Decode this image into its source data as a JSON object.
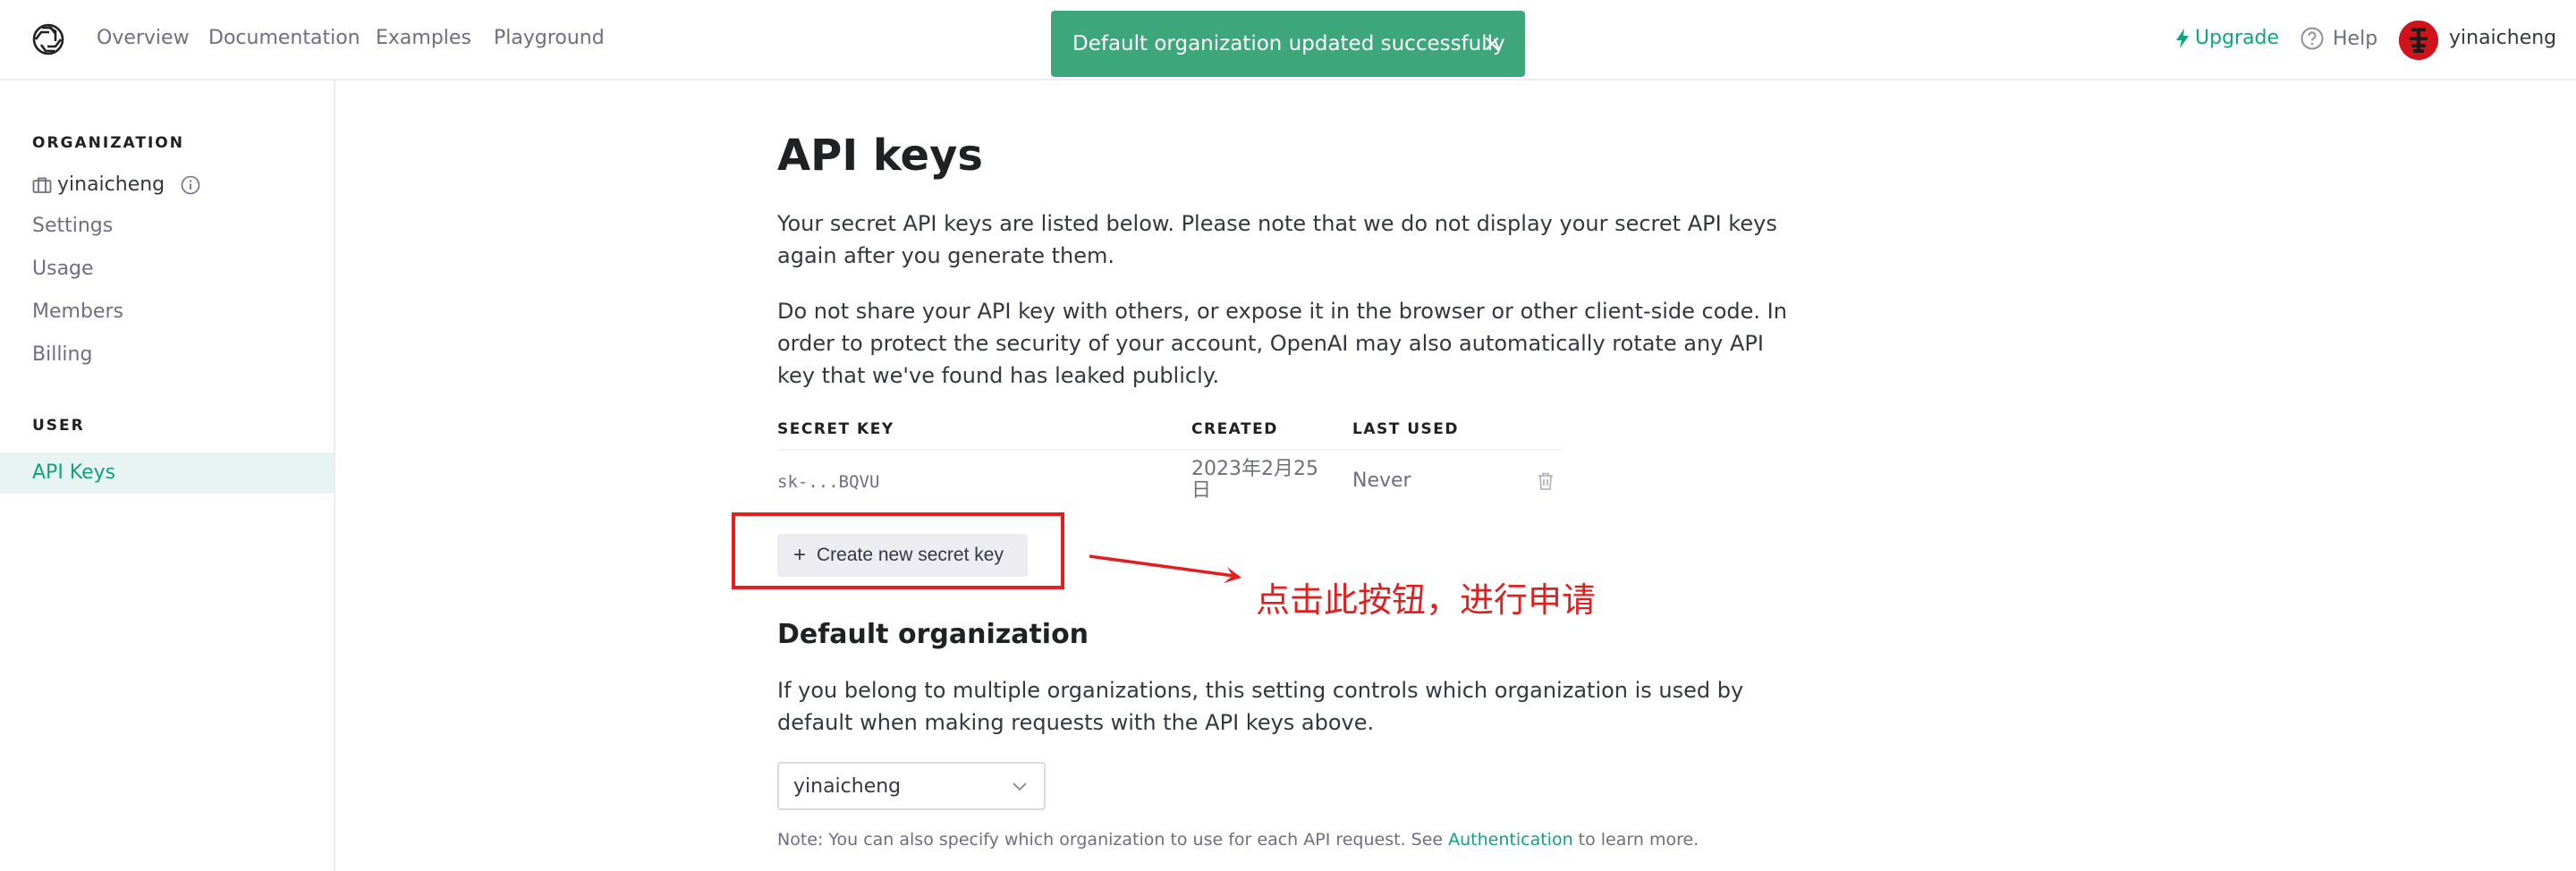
{
  "nav": {
    "links": [
      "Overview",
      "Documentation",
      "Examples",
      "Playground"
    ],
    "upgrade": "Upgrade",
    "help": "Help",
    "username": "yinaicheng"
  },
  "toast": {
    "message": "Default organization updated successfully",
    "close": "×"
  },
  "sidebar": {
    "org_section": "ORGANIZATION",
    "org_name": "yinaicheng",
    "org_items": [
      "Settings",
      "Usage",
      "Members",
      "Billing"
    ],
    "user_section": "USER",
    "active_item": "API Keys"
  },
  "main": {
    "title": "API keys",
    "para1": "Your secret API keys are listed below. Please note that we do not display your secret API keys again after you generate them.",
    "para2": "Do not share your API key with others, or expose it in the browser or other client-side code. In order to protect the security of your account, OpenAI may also automatically rotate any API key that we've found has leaked publicly.",
    "table": {
      "headers": [
        "SECRET KEY",
        "CREATED",
        "LAST USED"
      ],
      "rows": [
        {
          "key": "sk-...BQVU",
          "created_line1": "2023年2月25",
          "created_line2": "日",
          "last_used": "Never"
        }
      ]
    },
    "create_button": "Create new secret key",
    "annotation": "点击此按钮，进行申请",
    "default_org_title": "Default organization",
    "default_org_desc": "If you belong to multiple organizations, this setting controls which organization is used by default when making requests with the API keys above.",
    "select_value": "yinaicheng",
    "note_prefix": "Note: You can also specify which organization to use for each API request. See ",
    "note_link": "Authentication",
    "note_suffix": " to learn more."
  },
  "colors": {
    "accent": "#10a37f",
    "toast_bg": "#3da67a",
    "annotation_red": "#e02020"
  }
}
